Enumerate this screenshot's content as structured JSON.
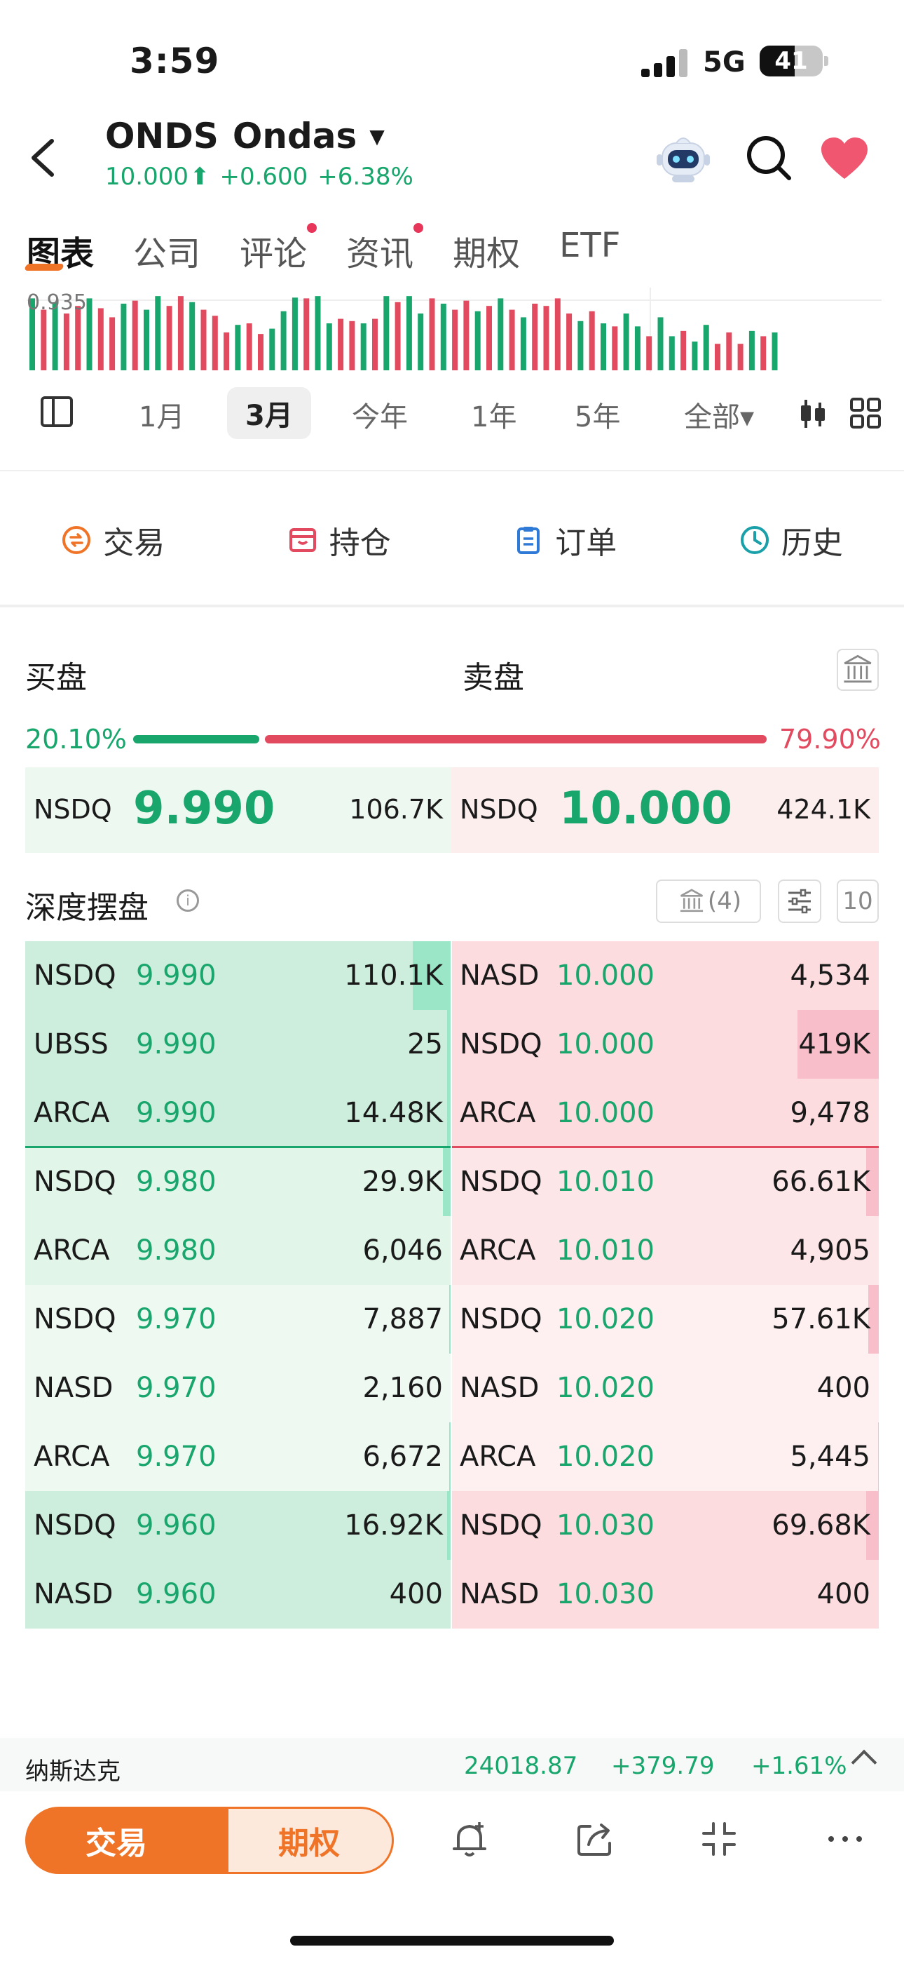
{
  "status": {
    "time": "3:59",
    "network": "5G",
    "battery": "41"
  },
  "header": {
    "symbol": "ONDS",
    "name": "Ondas",
    "price": "10.000",
    "arrow": "⬆",
    "change": "+0.600",
    "change_pct": "+6.38%"
  },
  "tabs": [
    {
      "label": "图表",
      "active": true,
      "dot": false
    },
    {
      "label": "公司",
      "active": false,
      "dot": false
    },
    {
      "label": "评论",
      "active": false,
      "dot": true
    },
    {
      "label": "资讯",
      "active": false,
      "dot": true
    },
    {
      "label": "期权",
      "active": false,
      "dot": false
    },
    {
      "label": "ETF",
      "active": false,
      "dot": false
    }
  ],
  "mini_chart": {
    "label": "0.935",
    "bars": [
      {
        "v": 0.95,
        "c": "g"
      },
      {
        "v": 0.8,
        "c": "r"
      },
      {
        "v": 0.9,
        "c": "g"
      },
      {
        "v": 0.75,
        "c": "r"
      },
      {
        "v": 0.85,
        "c": "r"
      },
      {
        "v": 0.95,
        "c": "g"
      },
      {
        "v": 0.82,
        "c": "r"
      },
      {
        "v": 0.7,
        "c": "r"
      },
      {
        "v": 0.88,
        "c": "g"
      },
      {
        "v": 0.92,
        "c": "r"
      },
      {
        "v": 0.8,
        "c": "g"
      },
      {
        "v": 0.98,
        "c": "g"
      },
      {
        "v": 0.85,
        "c": "r"
      },
      {
        "v": 0.98,
        "c": "r"
      },
      {
        "v": 0.9,
        "c": "g"
      },
      {
        "v": 0.8,
        "c": "r"
      },
      {
        "v": 0.72,
        "c": "r"
      },
      {
        "v": 0.5,
        "c": "r"
      },
      {
        "v": 0.6,
        "c": "g"
      },
      {
        "v": 0.62,
        "c": "r"
      },
      {
        "v": 0.48,
        "c": "r"
      },
      {
        "v": 0.55,
        "c": "g"
      },
      {
        "v": 0.78,
        "c": "g"
      },
      {
        "v": 0.96,
        "c": "g"
      },
      {
        "v": 0.95,
        "c": "r"
      },
      {
        "v": 0.98,
        "c": "g"
      },
      {
        "v": 0.62,
        "c": "g"
      },
      {
        "v": 0.68,
        "c": "r"
      },
      {
        "v": 0.65,
        "c": "r"
      },
      {
        "v": 0.62,
        "c": "g"
      },
      {
        "v": 0.68,
        "c": "r"
      },
      {
        "v": 0.98,
        "c": "g"
      },
      {
        "v": 0.9,
        "c": "r"
      },
      {
        "v": 0.98,
        "c": "g"
      },
      {
        "v": 0.75,
        "c": "g"
      },
      {
        "v": 0.95,
        "c": "r"
      },
      {
        "v": 0.88,
        "c": "g"
      },
      {
        "v": 0.8,
        "c": "r"
      },
      {
        "v": 0.92,
        "c": "r"
      },
      {
        "v": 0.78,
        "c": "g"
      },
      {
        "v": 0.85,
        "c": "r"
      },
      {
        "v": 0.95,
        "c": "g"
      },
      {
        "v": 0.8,
        "c": "r"
      },
      {
        "v": 0.7,
        "c": "g"
      },
      {
        "v": 0.88,
        "c": "r"
      },
      {
        "v": 0.85,
        "c": "r"
      },
      {
        "v": 0.95,
        "c": "r"
      },
      {
        "v": 0.75,
        "c": "r"
      },
      {
        "v": 0.65,
        "c": "g"
      },
      {
        "v": 0.78,
        "c": "r"
      },
      {
        "v": 0.62,
        "c": "g"
      },
      {
        "v": 0.58,
        "c": "r"
      },
      {
        "v": 0.75,
        "c": "g"
      },
      {
        "v": 0.58,
        "c": "g"
      },
      {
        "v": 0.45,
        "c": "r"
      },
      {
        "v": 0.7,
        "c": "g"
      },
      {
        "v": 0.45,
        "c": "g"
      },
      {
        "v": 0.52,
        "c": "r"
      },
      {
        "v": 0.38,
        "c": "g"
      },
      {
        "v": 0.6,
        "c": "g"
      },
      {
        "v": 0.35,
        "c": "r"
      },
      {
        "v": 0.5,
        "c": "r"
      },
      {
        "v": 0.35,
        "c": "r"
      },
      {
        "v": 0.52,
        "c": "g"
      },
      {
        "v": 0.45,
        "c": "r"
      },
      {
        "v": 0.5,
        "c": "g"
      }
    ]
  },
  "periods": [
    {
      "label": "1月",
      "selected": false
    },
    {
      "label": "3月",
      "selected": true
    },
    {
      "label": "今年",
      "selected": false
    },
    {
      "label": "1年",
      "selected": false
    },
    {
      "label": "5年",
      "selected": false
    },
    {
      "label": "全部▾",
      "selected": false
    }
  ],
  "actions": [
    {
      "label": "交易",
      "icon": "trade-icon",
      "color": "#f07427"
    },
    {
      "label": "持仓",
      "icon": "position-icon",
      "color": "#e24a5f"
    },
    {
      "label": "订单",
      "icon": "order-icon",
      "color": "#2f7ad6"
    },
    {
      "label": "历史",
      "icon": "history-icon",
      "color": "#1aa0a8"
    }
  ],
  "book": {
    "bid_title": "买盘",
    "ask_title": "卖盘",
    "bid_ratio": "20.10%",
    "ask_ratio": "79.90%",
    "bid_ratio_value": 0.201,
    "best_bid": {
      "exchange": "NSDQ",
      "price": "9.990",
      "size": "106.7K"
    },
    "best_ask": {
      "exchange": "NSDQ",
      "price": "10.000",
      "size": "424.1K"
    }
  },
  "depth": {
    "title": "深度摆盘",
    "bank_count": "(4)",
    "levels": "10",
    "bids": [
      {
        "exchange": "NSDQ",
        "price": "9.990",
        "size": "110.1K",
        "share": 0.09,
        "tier": 1
      },
      {
        "exchange": "UBSS",
        "price": "9.990",
        "size": "25",
        "share": 0.01,
        "tier": 1
      },
      {
        "exchange": "ARCA",
        "price": "9.990",
        "size": "14.48K",
        "share": 0.01,
        "tier": 1
      },
      {
        "exchange": "NSDQ",
        "price": "9.980",
        "size": "29.9K",
        "share": 0.02,
        "tier": 2
      },
      {
        "exchange": "ARCA",
        "price": "9.980",
        "size": "6,046",
        "share": 0.0,
        "tier": 2
      },
      {
        "exchange": "NSDQ",
        "price": "9.970",
        "size": "7,887",
        "share": 0.005,
        "tier": 3
      },
      {
        "exchange": "NASD",
        "price": "9.970",
        "size": "2,160",
        "share": 0.0,
        "tier": 3
      },
      {
        "exchange": "ARCA",
        "price": "9.970",
        "size": "6,672",
        "share": 0.005,
        "tier": 3
      },
      {
        "exchange": "NSDQ",
        "price": "9.960",
        "size": "16.92K",
        "share": 0.01,
        "tier": 1
      },
      {
        "exchange": "NASD",
        "price": "9.960",
        "size": "400",
        "share": 0.0,
        "tier": 1
      }
    ],
    "asks": [
      {
        "exchange": "NASD",
        "price": "10.000",
        "size": "4,534",
        "share": 0.0,
        "tier": 1
      },
      {
        "exchange": "NSDQ",
        "price": "10.000",
        "size": "419K",
        "share": 0.19,
        "tier": 1
      },
      {
        "exchange": "ARCA",
        "price": "10.000",
        "size": "9,478",
        "share": 0.0,
        "tier": 1
      },
      {
        "exchange": "NSDQ",
        "price": "10.010",
        "size": "66.61K",
        "share": 0.03,
        "tier": 2
      },
      {
        "exchange": "ARCA",
        "price": "10.010",
        "size": "4,905",
        "share": 0.0,
        "tier": 2
      },
      {
        "exchange": "NSDQ",
        "price": "10.020",
        "size": "57.61K",
        "share": 0.025,
        "tier": 3
      },
      {
        "exchange": "NASD",
        "price": "10.020",
        "size": "400",
        "share": 0.0,
        "tier": 3
      },
      {
        "exchange": "ARCA",
        "price": "10.020",
        "size": "5,445",
        "share": 0.002,
        "tier": 3
      },
      {
        "exchange": "NSDQ",
        "price": "10.030",
        "size": "69.68K",
        "share": 0.03,
        "tier": 1
      },
      {
        "exchange": "NASD",
        "price": "10.030",
        "size": "400",
        "share": 0.0,
        "tier": 1
      }
    ]
  },
  "index_ticker": {
    "name": "纳斯达克",
    "value": "24018.87",
    "change": "+379.79",
    "change_pct": "+1.61%"
  },
  "bottom": {
    "trade_label": "交易",
    "options_label": "期权"
  },
  "colors": {
    "up": "#18a66d",
    "down": "#e24a5f",
    "accent": "#f07427"
  }
}
